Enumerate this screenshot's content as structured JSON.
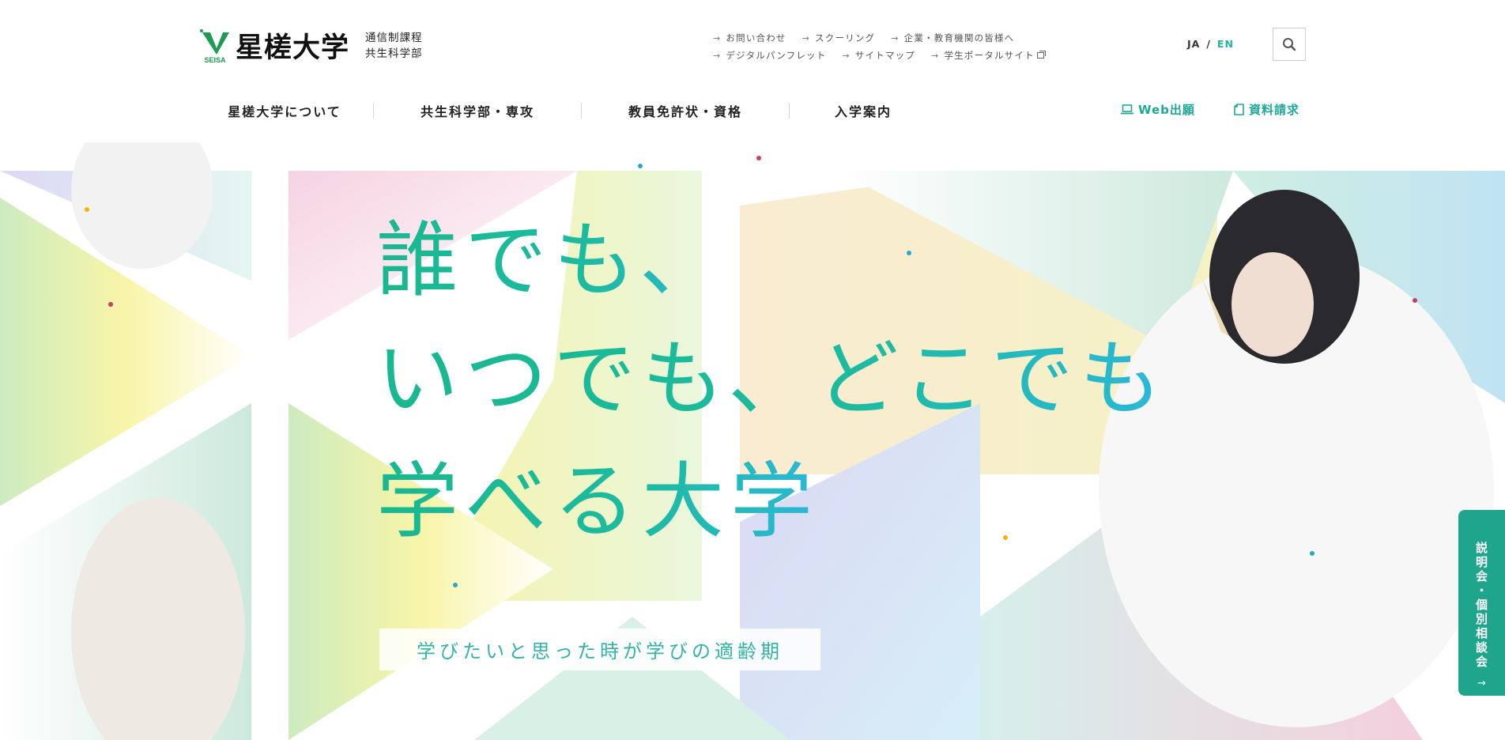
{
  "header": {
    "logo": {
      "mark_text": "SEISA",
      "name": "星槎大学",
      "sub_line1": "通信制課程",
      "sub_line2": "共生科学部"
    },
    "util_links_row1": [
      "お問い合わせ",
      "スクーリング",
      "企業・教育機関の皆様へ"
    ],
    "util_links_row2": [
      "デジタルパンフレット",
      "サイトマップ",
      "学生ポータルサイト"
    ],
    "lang": {
      "ja": "JA",
      "sep": "/",
      "en": "EN"
    },
    "search_icon": "search-icon",
    "nav": [
      "星槎大学について",
      "共生科学部・専攻",
      "教員免許状・資格",
      "入学案内"
    ],
    "cta": {
      "web_apply": "Web出願",
      "brochure": "資料請求"
    },
    "accent_color": "#20b49a"
  },
  "hero": {
    "headline_line1": "誰でも、",
    "headline_line2": "いつでも、どこでも",
    "headline_line3": "学べる大学",
    "tagline": "学びたいと思った時が学びの適齢期",
    "gradient_colors": [
      "#19b890",
      "#2bb8d8"
    ]
  },
  "side_tab": {
    "label": "説明会・個別相談会",
    "arrow": "→"
  }
}
